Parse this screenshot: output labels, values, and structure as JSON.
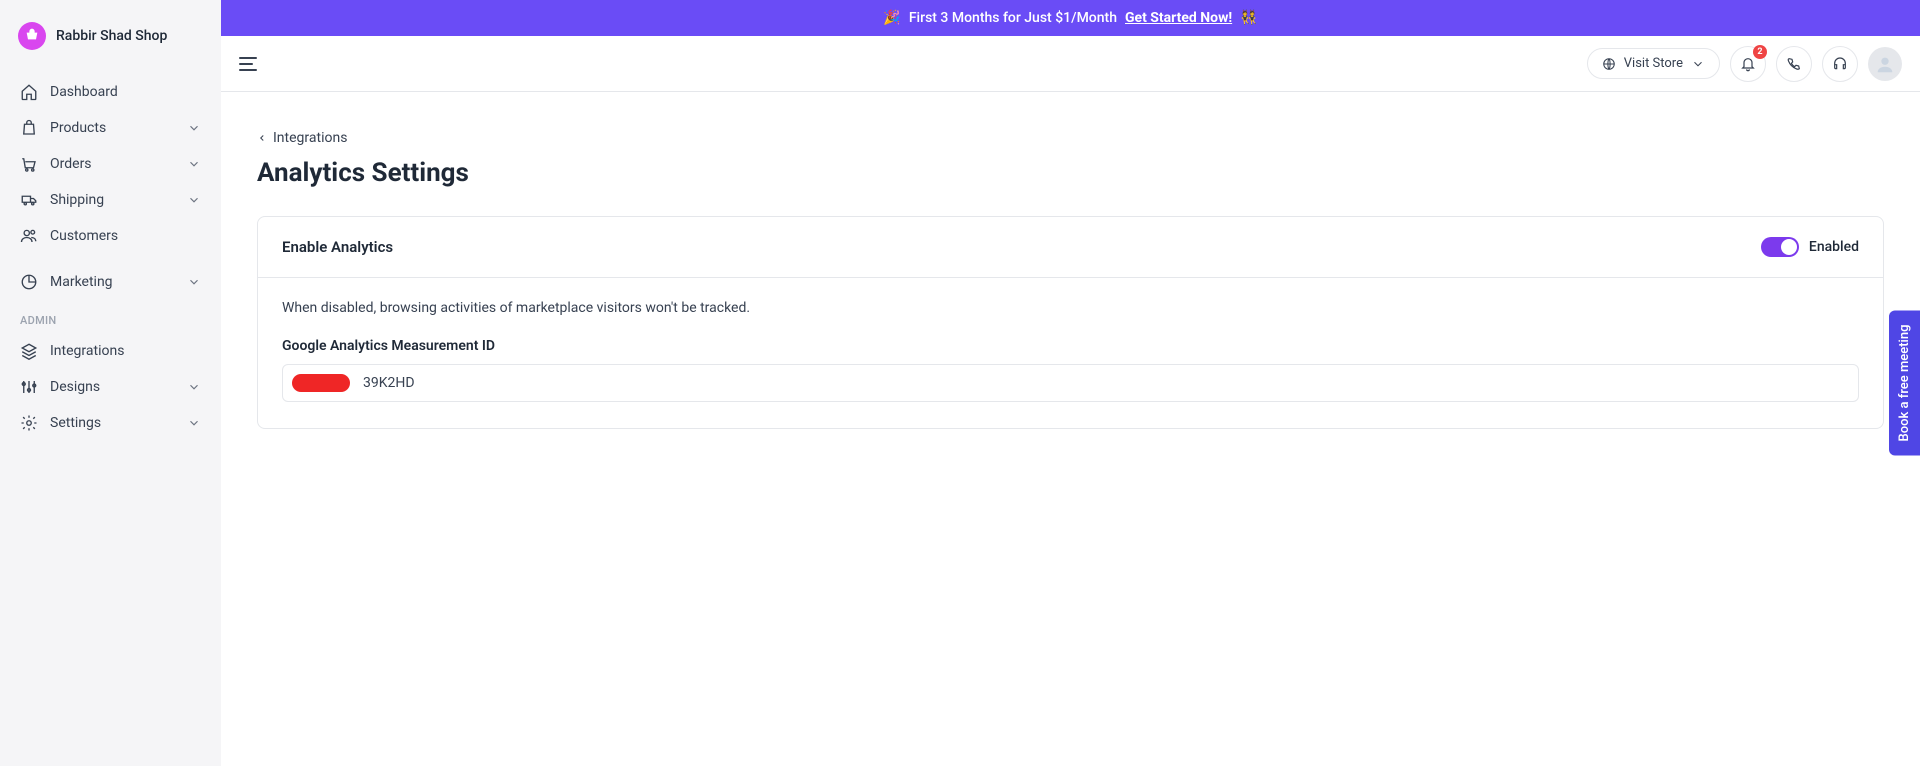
{
  "brand": {
    "name": "Rabbir Shad Shop"
  },
  "sidebar": {
    "items": [
      {
        "label": "Dashboard",
        "expandable": false
      },
      {
        "label": "Products",
        "expandable": true
      },
      {
        "label": "Orders",
        "expandable": true
      },
      {
        "label": "Shipping",
        "expandable": true
      },
      {
        "label": "Customers",
        "expandable": false
      },
      {
        "label": "Marketing",
        "expandable": true
      }
    ],
    "admin_label": "ADMIN",
    "admin_items": [
      {
        "label": "Integrations",
        "expandable": false
      },
      {
        "label": "Designs",
        "expandable": true
      },
      {
        "label": "Settings",
        "expandable": true
      }
    ]
  },
  "promo": {
    "emoji_left": "🎉",
    "text": "First 3 Months for Just $1/Month",
    "cta": "Get Started Now!",
    "emoji_right": "👯"
  },
  "topbar": {
    "visit_store_label": "Visit Store",
    "notification_badge": "2"
  },
  "breadcrumb": {
    "back_label": "Integrations"
  },
  "page": {
    "title": "Analytics Settings"
  },
  "card": {
    "enable_label": "Enable Analytics",
    "toggle_state_label": "Enabled",
    "description": "When disabled, browsing activities of marketplace visitors won't be tracked.",
    "field_label": "Google Analytics Measurement ID",
    "field_value_visible_suffix": "39K2HD"
  },
  "floating_cta": {
    "label": "Book a free meeting"
  }
}
